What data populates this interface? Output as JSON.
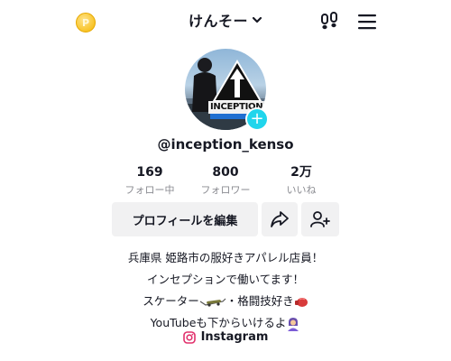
{
  "header": {
    "title": "けんそー",
    "coin_symbol": "P"
  },
  "profile": {
    "username": "@inception_kenso",
    "avatar_text": "INCEPTION"
  },
  "stats": [
    {
      "value": "169",
      "label": "フォロー中"
    },
    {
      "value": "800",
      "label": "フォロワー"
    },
    {
      "value": "2万",
      "label": "いいね"
    }
  ],
  "actions": {
    "edit_profile_label": "プロフィールを編集"
  },
  "bio": {
    "line1": "兵庫県 姫路市の服好きアパレル店員！",
    "line2": "インセプションで働いてます！",
    "line3a": "スケーター",
    "line3b": "・格闘技好き",
    "line4": "YouTubeも下からいけるよ"
  },
  "link": {
    "label": "Instagram"
  },
  "colors": {
    "accent": "#20d5ec",
    "button_bg": "#f1f1f2",
    "secondary_text": "#8a8b91"
  }
}
